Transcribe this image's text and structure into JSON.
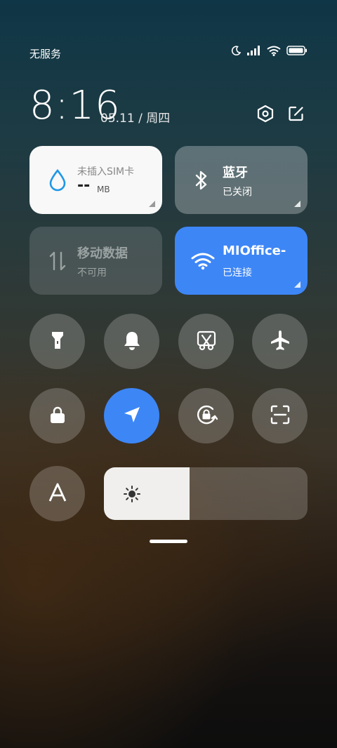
{
  "status_bar": {
    "carrier": "无服务",
    "icons": [
      "moon-icon",
      "signal-icon",
      "wifi-icon",
      "battery-icon"
    ]
  },
  "header": {
    "time": "8:16",
    "date": "05.11 / 周四",
    "settings_icon": "hexagon-gear-icon",
    "edit_icon": "edit-icon"
  },
  "tiles": {
    "sim": {
      "title": "未插入SIM卡",
      "value": "--",
      "unit": "MB",
      "icon": "droplet-icon"
    },
    "bluetooth": {
      "title": "蓝牙",
      "status": "已关闭",
      "icon": "bluetooth-icon"
    },
    "mobile_data": {
      "title": "移动数据",
      "status": "不可用",
      "icon": "data-arrows-icon"
    },
    "wifi": {
      "title": "MIOffice-",
      "status": "已连接",
      "icon": "wifi-icon"
    }
  },
  "toggles": [
    {
      "name": "flashlight",
      "icon": "flashlight-icon",
      "active": false
    },
    {
      "name": "sound",
      "icon": "bell-icon",
      "active": false
    },
    {
      "name": "screenshot",
      "icon": "scissors-icon",
      "active": false
    },
    {
      "name": "airplane-mode",
      "icon": "airplane-icon",
      "active": false
    },
    {
      "name": "lock-screen",
      "icon": "lock-icon",
      "active": false
    },
    {
      "name": "location",
      "icon": "location-arrow-icon",
      "active": true
    },
    {
      "name": "rotation-lock",
      "icon": "rotation-lock-icon",
      "active": false
    },
    {
      "name": "scanner",
      "icon": "scan-icon",
      "active": false
    },
    {
      "name": "auto-brightness",
      "icon": "letter-a-icon",
      "active": false
    }
  ],
  "brightness": {
    "level": 0.42,
    "icon": "sun-icon"
  },
  "colors": {
    "accent": "#3d86f6",
    "sim_blue": "#1f97e8"
  }
}
